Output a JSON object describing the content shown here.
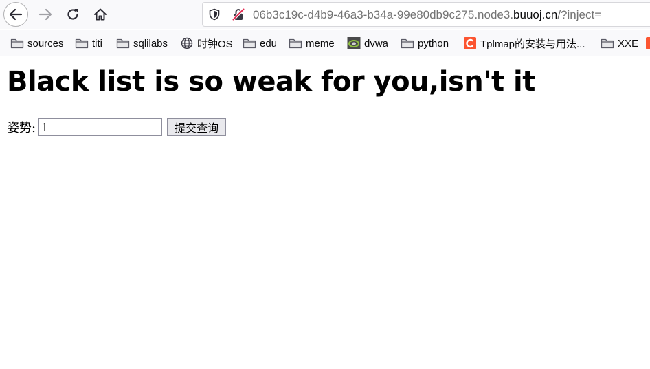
{
  "browser": {
    "url": {
      "prefix": "06b3c19c-d4b9-46a3-b34a-99e80db9c275.node3.",
      "host": "buuoj.cn",
      "suffix": "/?inject="
    },
    "bookmarks": [
      {
        "label": "sources",
        "icon": "folder-icon"
      },
      {
        "label": "titi",
        "icon": "folder-icon"
      },
      {
        "label": "sqlilabs",
        "icon": "folder-icon"
      },
      {
        "label": "时钟OS",
        "icon": "globe-icon"
      },
      {
        "label": "edu",
        "icon": "folder-icon"
      },
      {
        "label": "meme",
        "icon": "folder-icon"
      },
      {
        "label": "dvwa",
        "icon": "dvwa-favicon"
      },
      {
        "label": "python",
        "icon": "folder-icon"
      },
      {
        "label": "Tplmap的安装与用法...",
        "icon": "csdn-favicon"
      },
      {
        "label": "XXE",
        "icon": "folder-icon"
      }
    ]
  },
  "page": {
    "heading": "Black list is so weak for you,isn't it",
    "form": {
      "label": "姿势:",
      "input_value": "1",
      "submit_label": "提交查询"
    }
  },
  "colors": {
    "toolbar_bg": "#f9f9fb",
    "csdn_red": "#fc5531",
    "url_host": "#0c0c0d",
    "url_dim": "#737373"
  }
}
